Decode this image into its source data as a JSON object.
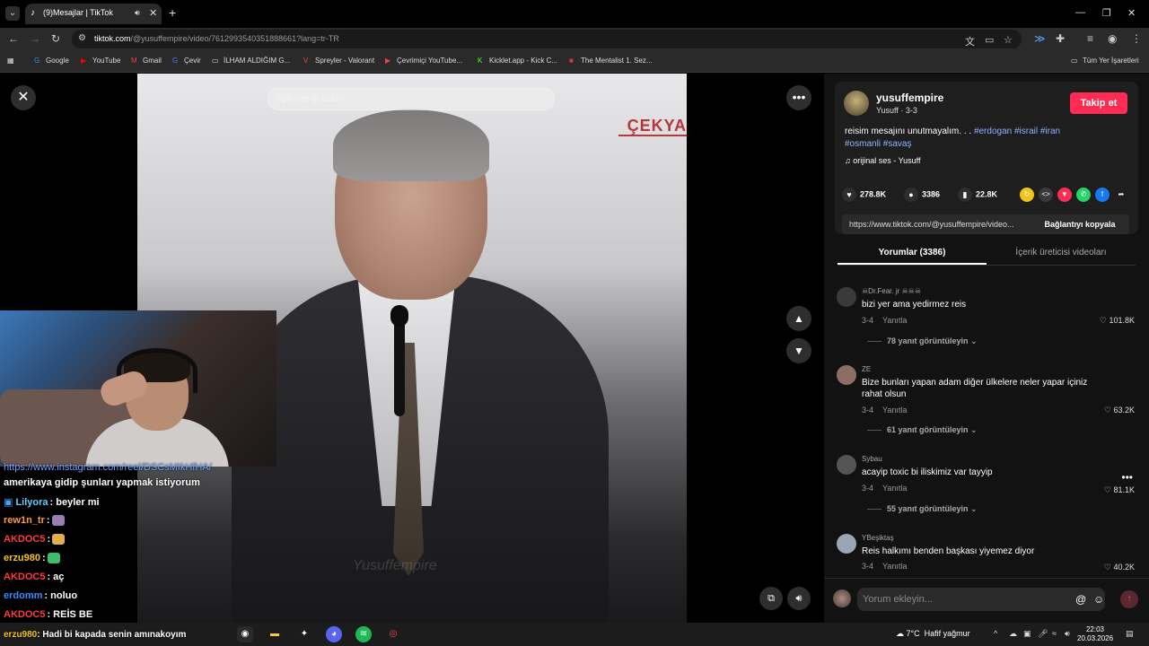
{
  "browser": {
    "tab_title": "(9)Mesajlar | TikTok",
    "url_host": "tiktok.com",
    "url_path": "/@yusuffempire/video/7612993540351888661?lang=tr-TR"
  },
  "bookmarks": {
    "items": [
      "Google",
      "YouTube",
      "Gmail",
      "Çevir",
      "İLHAM ALDIĞIM G...",
      "Spreyler - Valorant",
      "Çevrimiçi YouTube...",
      "Kicklet.app - Kick C...",
      "The Mentalist 1. Sez..."
    ],
    "all_bookmarks": "Tüm Yer İşaretleri"
  },
  "video": {
    "search_placeholder": "İlgili içeriği bulun",
    "overlay_brand": "ÇEKYA",
    "watermark": "Yusuffempire"
  },
  "chat": {
    "link_line": "https://www.instagram.com/reel/DSCsMIkHfHA/",
    "lines": [
      {
        "user": "",
        "text": "amerikaya gidip şunları yapmak istiyorum",
        "color": "#ffffff"
      },
      {
        "user": "Lilyora",
        "text": ": beyler mi",
        "color": "#ffffff"
      },
      {
        "user": "rew1n_tr",
        "text": ":",
        "color": "#ff9b3b"
      },
      {
        "user": "AKDOC5",
        "text": ":",
        "color": "#ff3b3b"
      },
      {
        "user": "erzu980",
        "text": ":",
        "color": "#f0c419"
      },
      {
        "user": "AKDOC5",
        "text": ": aç",
        "color": "#ff3b3b"
      },
      {
        "user": "erdomm",
        "text": ": noluo",
        "color": "#3b8bff"
      },
      {
        "user": "AKDOC5",
        "text": ": REİS BE",
        "color": "#ff3b3b"
      }
    ],
    "taskbar_line_user": "erzu980",
    "taskbar_line_text": ": Hadi bi kapada senin amınakoyım"
  },
  "author": {
    "name": "yusuffempire",
    "sub": "Yusuff · 3-3",
    "follow_label": "Takip et",
    "caption_text": "reisim mesajını unutmayalım. . . ",
    "hashtags_line1": "#erdogan #israil #iran",
    "hashtags_line2": "#osmanli #savaş",
    "music": "orijinal ses - Yusuff"
  },
  "actions": {
    "likes": "278.8K",
    "comments": "3386",
    "saves": "22.8K"
  },
  "share": {
    "link": "https://www.tiktok.com/@yusuffempire/video...",
    "copy_label": "Bağlantıyı kopyala"
  },
  "tabs": {
    "comments": "Yorumlar (3386)",
    "creator_videos": "İçerik üreticisi videoları"
  },
  "comments": [
    {
      "user": "☠Dr.Fear. jr ☠☠☠",
      "text": "bizi yer ama yedirmez reis",
      "date": "3-4",
      "reply": "Yanıtla",
      "likes": "101.8K",
      "replies": "78 yanıt görüntüleyin"
    },
    {
      "user": "ZE",
      "text": "Bize bunları yapan adam diğer ülkelere neler yapar içiniz rahat olsun",
      "date": "3-4",
      "reply": "Yanıtla",
      "likes": "63.2K",
      "replies": "61 yanıt görüntüleyin"
    },
    {
      "user": "Sybau",
      "text": "acayip toxic bi iliskimiz var tayyip",
      "date": "3-4",
      "reply": "Yanıtla",
      "likes": "81.1K",
      "replies": "55 yanıt görüntüleyin"
    },
    {
      "user": "YBeşiktaş",
      "text": "Reis halkımı benden başkası yiyemez diyor",
      "date": "3-4",
      "reply": "Yanıtla",
      "likes": "40.2K",
      "replies": ""
    }
  ],
  "comment_input": {
    "placeholder": "Yorum ekleyin..."
  },
  "taskbar": {
    "temperature": "7°C",
    "weather": "Hafif yağmur",
    "time": "22:03",
    "date": "20.03.2026"
  },
  "colors": {
    "accent": "#fe2c55",
    "hashtag": "#8fb2ff"
  }
}
